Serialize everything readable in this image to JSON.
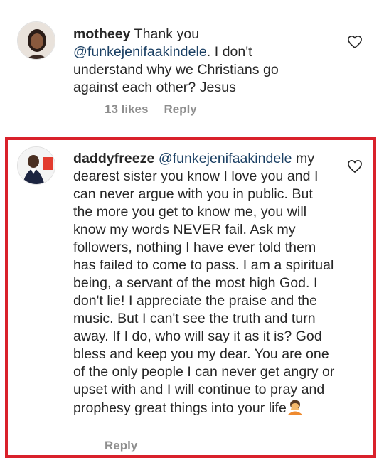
{
  "comments": [
    {
      "username": "motheey",
      "text_before": " Thank you ",
      "mention": "@funkejenifaakindele",
      "text_after": ". I don't understand why we Christians go against each other? Jesus",
      "likes": "13 likes",
      "reply_label": "Reply"
    },
    {
      "username": "daddyfreeze",
      "text_before": " ",
      "mention": "@funkejenifaakindele",
      "text_after": " my dearest sister you know I love you and I can never argue with you in public. But the more you get to know me, you will know my words NEVER fail. Ask my followers, nothing I have ever told them has failed to come to pass. I am a spiritual being, a servant of the most high God. I don't lie! I appreciate the praise and the music. But I can't see the truth and turn away. If I do, who will say it as it is? God bless and keep you my dear. You are one of the only people I can never get angry or upset with and I will continue to pray and prophesy great things into your life",
      "reply_label": "Reply",
      "emoji": "person-bowing-emoji"
    }
  ],
  "colors": {
    "highlight_border": "#d9212b",
    "mention": "#1a3f63",
    "meta_text": "#8e8e8e"
  }
}
